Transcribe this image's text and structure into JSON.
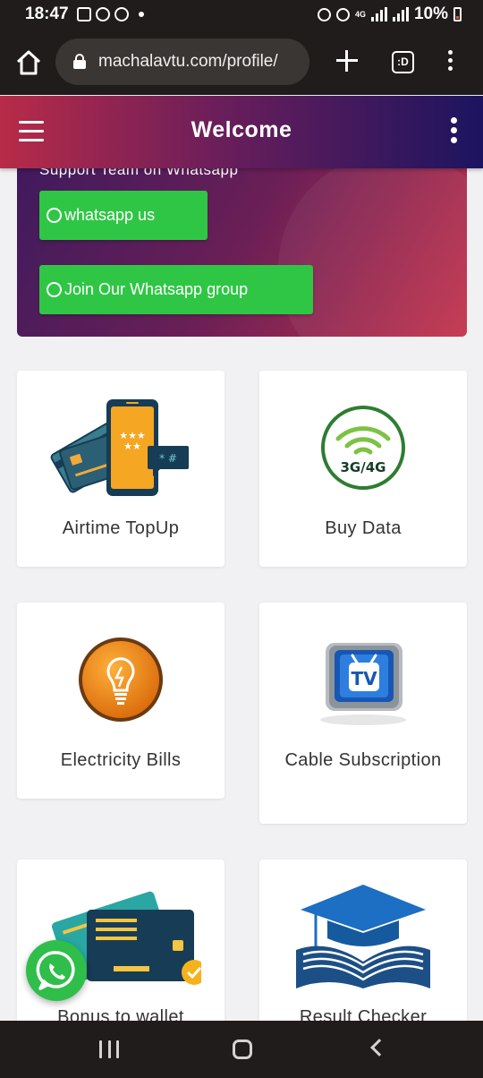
{
  "status_bar": {
    "time": "18:47",
    "network": "4G",
    "battery": "10%"
  },
  "browser": {
    "url": "machalavtu.com/profile/",
    "tab_label": ":D"
  },
  "header": {
    "title": "Welcome"
  },
  "support": {
    "text": "Support Team on Whatsapp",
    "whatsapp_button": "whatsapp us",
    "group_button": "Join Our Whatsapp group"
  },
  "services": [
    {
      "label": "Airtime TopUp",
      "icon": "airtime-phone-icon"
    },
    {
      "label": "Buy Data",
      "icon": "data-3g4g-icon"
    },
    {
      "label": "Electricity Bills",
      "icon": "lightbulb-icon"
    },
    {
      "label": "Cable Subscription",
      "icon": "tv-icon"
    },
    {
      "label": "Bonus to wallet",
      "icon": "wallet-card-icon"
    },
    {
      "label": "Result Checker",
      "icon": "graduation-book-icon"
    }
  ],
  "data_icon_text": "3G/4G",
  "tv_icon_text": "TV",
  "colors": {
    "header_gradient_start": "#b82b48",
    "header_gradient_end": "#1c1460",
    "whatsapp_green": "#2fc645"
  }
}
